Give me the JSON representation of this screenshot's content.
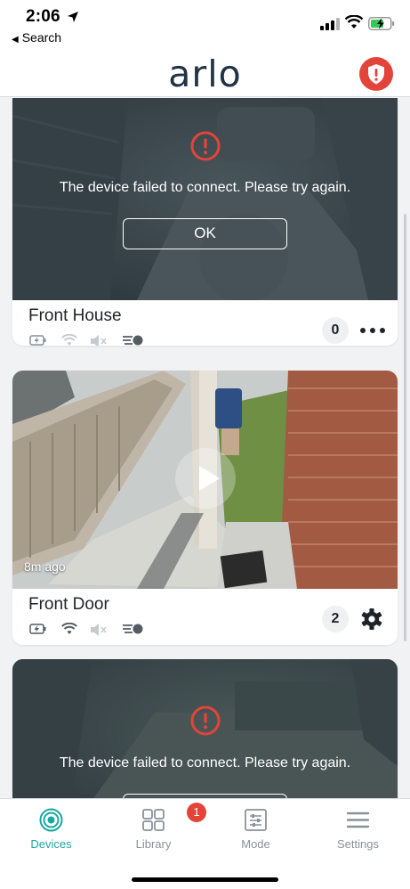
{
  "status_bar": {
    "time": "2:06",
    "back_label": "Search"
  },
  "header": {
    "logo": "arlo"
  },
  "devices": [
    {
      "name": "Front House",
      "error_text": "The device failed to connect. Please try again.",
      "ok_label": "OK",
      "count": "0",
      "action": "more-menu"
    },
    {
      "name": "Front Door",
      "last_seen": "8m ago",
      "count": "2",
      "action": "settings"
    },
    {
      "error_text": "The device failed to connect. Please try again."
    }
  ],
  "tabs": [
    {
      "label": "Devices",
      "icon": "devices-icon",
      "active": true
    },
    {
      "label": "Library",
      "icon": "library-icon",
      "badge": "1"
    },
    {
      "label": "Mode",
      "icon": "mode-icon"
    },
    {
      "label": "Settings",
      "icon": "settings-icon"
    }
  ],
  "colors": {
    "accent": "#1aa7a0",
    "alert": "#e2443a",
    "error_icon": "#e2443a"
  }
}
